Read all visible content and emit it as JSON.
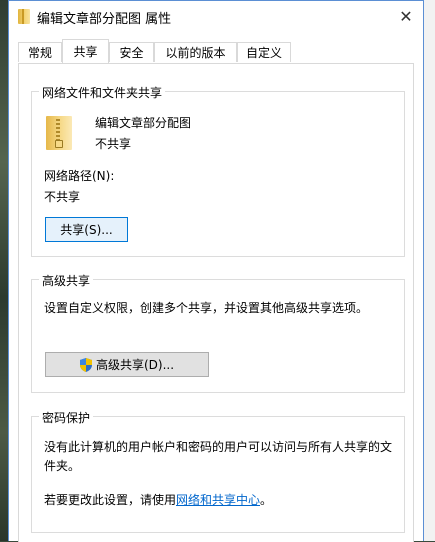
{
  "window": {
    "title": "编辑文章部分配图 属性",
    "close_glyph": "✕"
  },
  "tabs": [
    {
      "label": "常规",
      "active": false
    },
    {
      "label": "共享",
      "active": true
    },
    {
      "label": "安全",
      "active": false
    },
    {
      "label": "以前的版本",
      "active": false
    },
    {
      "label": "自定义",
      "active": false
    }
  ],
  "network_share": {
    "group_label": "网络文件和文件夹共享",
    "folder_name": "编辑文章部分配图",
    "folder_status": "不共享",
    "path_label": "网络路径(N):",
    "path_value": "不共享",
    "share_button": "共享(S)..."
  },
  "advanced_share": {
    "group_label": "高级共享",
    "description": "设置自定义权限，创建多个共享，并设置其他高级共享选项。",
    "button": "高级共享(D)..."
  },
  "password_protection": {
    "group_label": "密码保护",
    "description_line1": "没有此计算机的用户帐户和密码的用户可以访问与所有人共享的文",
    "description_line2": "件夹。",
    "change_prefix": "若要更改此设置，请使用",
    "change_link": "网络和共享中心",
    "change_suffix": "。"
  },
  "icons": {
    "title": "folder-icon",
    "close": "close-icon",
    "folder": "folder-icon",
    "advanced": "uac-shield-icon"
  },
  "colors": {
    "window_border": "#5b8fd4",
    "link": "#0066cc",
    "button_bg": "#e1e1e1",
    "focused_border": "#0078d7"
  }
}
